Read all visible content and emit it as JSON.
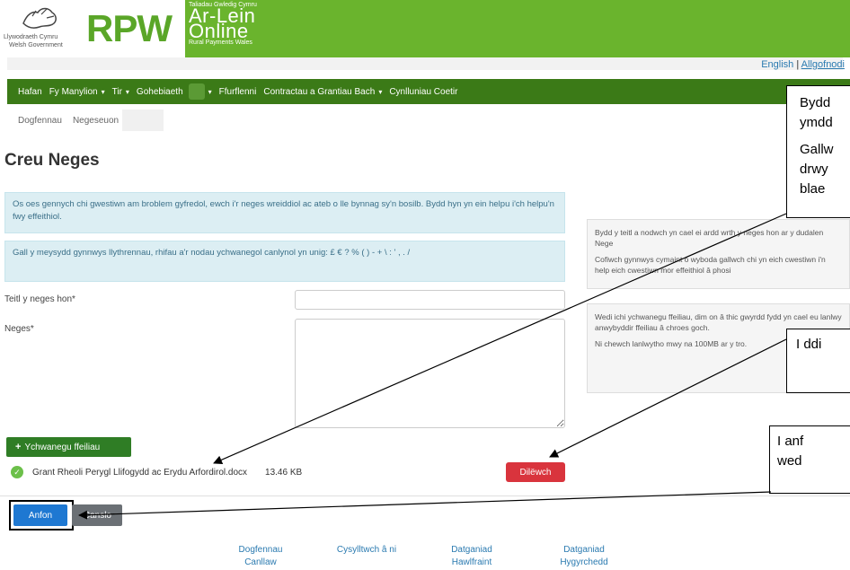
{
  "header": {
    "gov_cy": "Llywodraeth Cymru",
    "gov_en": "Welsh Government",
    "rpw": "RPW",
    "grant_line": "Taliadau Gwledig Cymru",
    "online_line1": "Ar-Lein",
    "online_line2": "Online",
    "rural": "Rural Payments Wales"
  },
  "util": {
    "english": "English",
    "sep": " | ",
    "logout": "Allgofnodi"
  },
  "nav": {
    "items": [
      {
        "label": "Hafan"
      },
      {
        "label": "Fy Manylion"
      },
      {
        "label": "Tir"
      },
      {
        "label": "Gohebiaeth"
      },
      {
        "label": "Ffurflenni"
      },
      {
        "label": "Contractau a Grantiau Bach"
      },
      {
        "label": "Cynlluniau Coetir"
      }
    ]
  },
  "subnav": {
    "docs": "Dogfennau",
    "messages": "Negeseuon"
  },
  "page_title": "Creu Neges",
  "info": {
    "general": "Os oes gennych chi gwestiwn am broblem gyfredol, ewch i'r neges wreiddiol ac ateb o lle bynnag sy'n bosilb. Bydd hyn yn ein helpu i'ch helpu'n fwy effeithiol.",
    "chars": "Gall y meysydd gynnwys llythrennau, rhifau a'r nodau ychwanegol canlynol yn unig: £ € ? % ( ) - + \\ : ' , . /"
  },
  "form": {
    "title_label": "Teitl y neges hon*",
    "title_value": "",
    "message_label": "Neges*",
    "message_value": ""
  },
  "help": {
    "p1": "Bydd y teitl a nodwch yn cael ei ardd wrth y neges hon ar y dudalen Nege",
    "p2": "Cofiwch gynnwys cymaint o wyboda gallwch chi yn eich cwestiwn i'n help eich cwestiwn mor effeithiol â phosi",
    "p3": "Wedi ichi ychwanegu ffeiliau, dim on â thic gwyrdd fydd yn cael eu lanlwy anwybyddir ffeiliau â chroes goch.",
    "p4": "Ni chewch lanlwytho mwy na 100MB ar y tro."
  },
  "callouts": {
    "c1_l1": "Bydd",
    "c1_l2": "ymdd",
    "c1_l3": "Gallw",
    "c1_l4": "drwy",
    "c1_l5": "blae",
    "c2": "I ddi",
    "c3_l1": "I anf",
    "c3_l2": "wed"
  },
  "files": {
    "add_label": "Ychwanegu ffeiliau",
    "name": "Grant Rheoli Perygl Llifogydd ac Erydu Arfordirol.docx",
    "size": "13.46 KB",
    "delete_label": "Dilëwch"
  },
  "actions": {
    "send": "Anfon",
    "cancel": "Canslo"
  },
  "footer": {
    "f1": "Dogfennau",
    "f1b": "Canllaw",
    "f2": "Cysylltwch â ni",
    "f3": "Datganiad",
    "f3b": "Hawlfraint",
    "f4": "Datganiad",
    "f4b": "Hygyrchedd"
  }
}
